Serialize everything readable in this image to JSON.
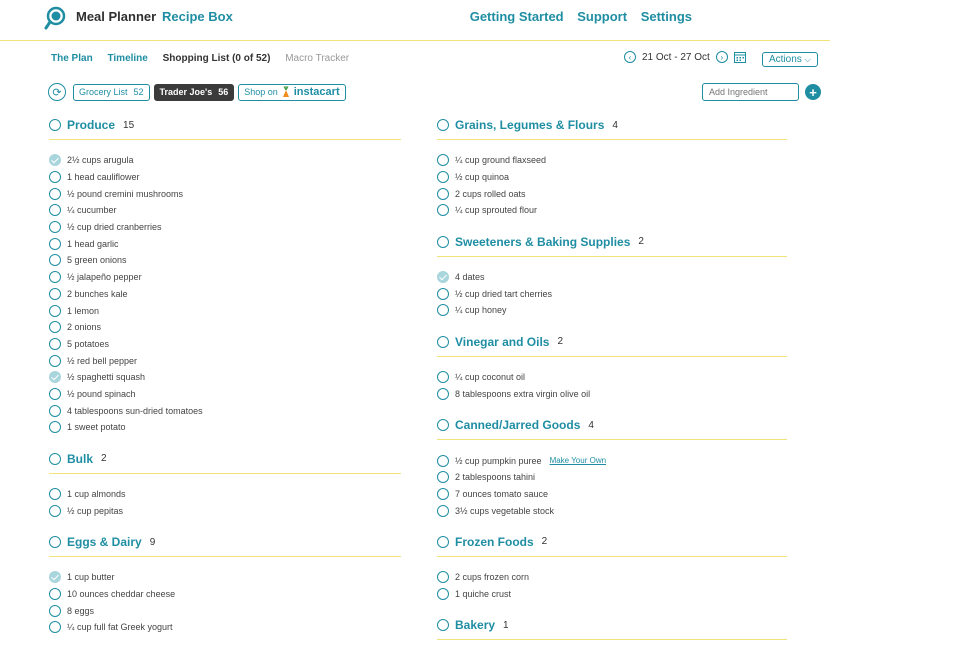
{
  "header": {
    "app_title": "Meal Planner",
    "recipe_box": "Recipe Box",
    "nav": [
      "Getting Started",
      "Support",
      "Settings"
    ]
  },
  "subnav": {
    "tabs": [
      {
        "label": "The Plan",
        "state": "link"
      },
      {
        "label": "Timeline",
        "state": "link"
      },
      {
        "label": "Shopping List (0 of 52)",
        "state": "active"
      },
      {
        "label": "Macro Tracker",
        "state": "muted"
      }
    ],
    "date_range": "21 Oct - 27 Oct",
    "actions_label": "Actions"
  },
  "stores": {
    "grocery": "Grocery List",
    "grocery_count": "52",
    "traderjoes": "Trader Joe's",
    "traderjoes_count": "56",
    "shop_on": "Shop on",
    "instacart": "instacart"
  },
  "add_ingredient_placeholder": "Add Ingredient",
  "left_sections": [
    {
      "title": "Produce",
      "count": "15",
      "items": [
        {
          "text": "2½ cups arugula",
          "checked": true
        },
        {
          "text": "1 head cauliflower",
          "checked": false
        },
        {
          "text": "½ pound cremini mushrooms",
          "checked": false
        },
        {
          "text": "¼ cucumber",
          "checked": false
        },
        {
          "text": "½ cup dried cranberries",
          "checked": false
        },
        {
          "text": "1 head garlic",
          "checked": false
        },
        {
          "text": "5 green onions",
          "checked": false
        },
        {
          "text": "½ jalapeño pepper",
          "checked": false
        },
        {
          "text": "2 bunches kale",
          "checked": false
        },
        {
          "text": "1 lemon",
          "checked": false
        },
        {
          "text": "2 onions",
          "checked": false
        },
        {
          "text": "5 potatoes",
          "checked": false
        },
        {
          "text": "½ red bell pepper",
          "checked": false
        },
        {
          "text": "½ spaghetti squash",
          "checked": true
        },
        {
          "text": "½ pound spinach",
          "checked": false
        },
        {
          "text": "4 tablespoons sun-dried tomatoes",
          "checked": false
        },
        {
          "text": "1 sweet potato",
          "checked": false
        }
      ]
    },
    {
      "title": "Bulk",
      "count": "2",
      "items": [
        {
          "text": "1 cup almonds",
          "checked": false
        },
        {
          "text": "½ cup pepitas",
          "checked": false
        }
      ]
    },
    {
      "title": "Eggs & Dairy",
      "count": "9",
      "items": [
        {
          "text": "1 cup butter",
          "checked": true
        },
        {
          "text": "10 ounces cheddar cheese",
          "checked": false
        },
        {
          "text": "8 eggs",
          "checked": false
        },
        {
          "text": "¼ cup full fat Greek yogurt",
          "checked": false
        }
      ]
    }
  ],
  "right_sections": [
    {
      "title": "Grains, Legumes & Flours",
      "count": "4",
      "items": [
        {
          "text": "¼ cup ground flaxseed",
          "checked": false
        },
        {
          "text": "½ cup quinoa",
          "checked": false
        },
        {
          "text": "2 cups rolled oats",
          "checked": false
        },
        {
          "text": "¼ cup sprouted flour",
          "checked": false
        }
      ]
    },
    {
      "title": "Sweeteners & Baking Supplies",
      "count": "2",
      "items": [
        {
          "text": "4 dates",
          "checked": true
        },
        {
          "text": "½ cup dried tart cherries",
          "checked": false
        },
        {
          "text": "¼ cup honey",
          "checked": false
        }
      ]
    },
    {
      "title": "Vinegar and Oils",
      "count": "2",
      "items": [
        {
          "text": "¼ cup coconut oil",
          "checked": false
        },
        {
          "text": "8 tablespoons extra virgin olive oil",
          "checked": false
        }
      ]
    },
    {
      "title": "Canned/Jarred Goods",
      "count": "4",
      "items": [
        {
          "text": "½ cup pumpkin puree",
          "checked": false,
          "link": "Make Your Own"
        },
        {
          "text": "2 tablespoons tahini",
          "checked": false
        },
        {
          "text": "7 ounces tomato sauce",
          "checked": false
        },
        {
          "text": "3½ cups vegetable stock",
          "checked": false
        }
      ]
    },
    {
      "title": "Frozen Foods",
      "count": "2",
      "items": [
        {
          "text": "2 cups frozen corn",
          "checked": false
        },
        {
          "text": "1 quiche crust",
          "checked": false
        }
      ]
    },
    {
      "title": "Bakery",
      "count": "1",
      "items": []
    }
  ],
  "colors": {
    "accent": "#1f8ea3",
    "divider": "#f2e27a",
    "selected_tab": "#3b3b3b",
    "checked": "#a9d5dc"
  }
}
